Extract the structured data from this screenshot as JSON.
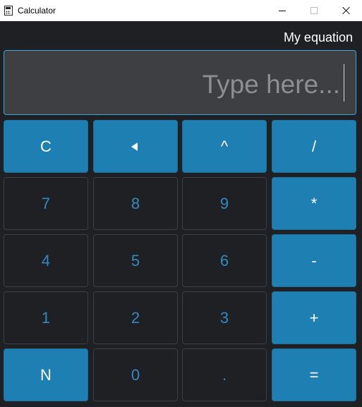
{
  "window": {
    "title": "Calculator",
    "icon": "calculator-icon",
    "controls": [
      "minimize-icon",
      "maximize-icon",
      "close-icon"
    ]
  },
  "header": {
    "label": "My equation"
  },
  "input": {
    "placeholder": "Type here..."
  },
  "keys": {
    "clear": "C",
    "backspace_icon": "left-triangle-icon",
    "power": "^",
    "divide": "/",
    "seven": "7",
    "eight": "8",
    "nine": "9",
    "multiply": "*",
    "four": "4",
    "five": "5",
    "six": "6",
    "subtract": "-",
    "one": "1",
    "two": "2",
    "three": "3",
    "add": "+",
    "negate": "N",
    "zero": "0",
    "decimal": ".",
    "equals": "="
  },
  "colors": {
    "background": "#1f2023",
    "operator_key": "#1e80b2",
    "number_text": "#3388c2",
    "input_border": "#3aa6d8",
    "input_background": "#3d3f42"
  }
}
